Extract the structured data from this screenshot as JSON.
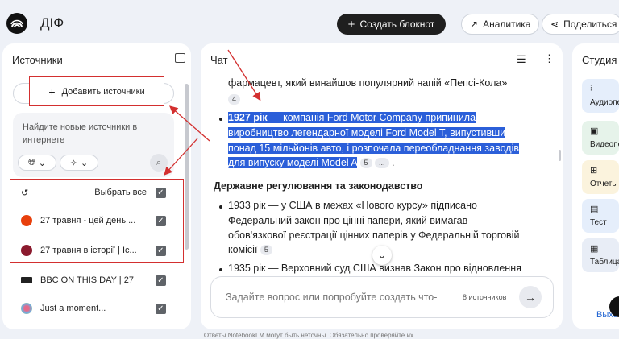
{
  "header": {
    "title": "ДІФ",
    "create_label": "Создать блокнот",
    "analytics_label": "Аналитика",
    "share_label": "Поделиться"
  },
  "sources": {
    "title": "Источники",
    "add_label": "Добавить источники",
    "search_hint": "Найдите новые источники в интернете",
    "select_all_label": "Выбрать все",
    "items": [
      {
        "label": "27 травня - цей день ...",
        "color": "#e8400c"
      },
      {
        "label": "27 травня в історії | Іс...",
        "color": "#8b1a2e"
      },
      {
        "label": "BBC ON THIS DAY | 27",
        "color": "#222222"
      },
      {
        "label": "Just a moment...",
        "color": "#e56a8a"
      }
    ]
  },
  "chat": {
    "title": "Чат",
    "line0": "фармацевт, який винайшов популярний напій «Пепсі-Кола»",
    "cite0": "4",
    "b1_l1_year": "1927 рік",
    "b1_l1_rest": " — компанія Ford Motor Company припинила",
    "b1_l2": "виробництво легендарної моделі Ford Model T, випустивши",
    "b1_l3": "понад 15 мільйонів авто, і розпочала переобладнання заводів",
    "b1_l4": "для випуску моделі Model A",
    "cite1": "5",
    "cite1b": "...",
    "section_heading": "Державне регулювання та законодавство",
    "b2_l1": "1933 рік — у США в межах «Нового курсу» підписано",
    "b2_l2": "Федеральний закон про цінні папери, який вимагав",
    "b2_l3": "обов'язкової реєстрації цінних паперів у Федеральній торговій",
    "b2_l4": "комісії",
    "cite2": "5",
    "b3_l1": "1935 рік — Верховний суд США визнав Закон про відновлення",
    "input_placeholder": "Задайте вопрос или попробуйте создать что-",
    "source_count": "8 источников"
  },
  "studio": {
    "title": "Студия",
    "cards": [
      {
        "label": "Аудиопе",
        "color": "#e5eefb",
        "icon": "audio-icon"
      },
      {
        "label": "Видеопе",
        "color": "#e6f3ea",
        "icon": "video-icon"
      },
      {
        "label": "Отчеты",
        "color": "#fbf3dd",
        "icon": "report-icon"
      },
      {
        "label": "Тест",
        "color": "#e5eefb",
        "icon": "quiz-icon"
      },
      {
        "label": "Таблица",
        "color": "#e8edf6",
        "icon": "table-icon"
      }
    ],
    "more_label": "Выхо"
  },
  "footer": "Ответы NotebookLM могут быть неточны. Обязательно проверяйте их."
}
